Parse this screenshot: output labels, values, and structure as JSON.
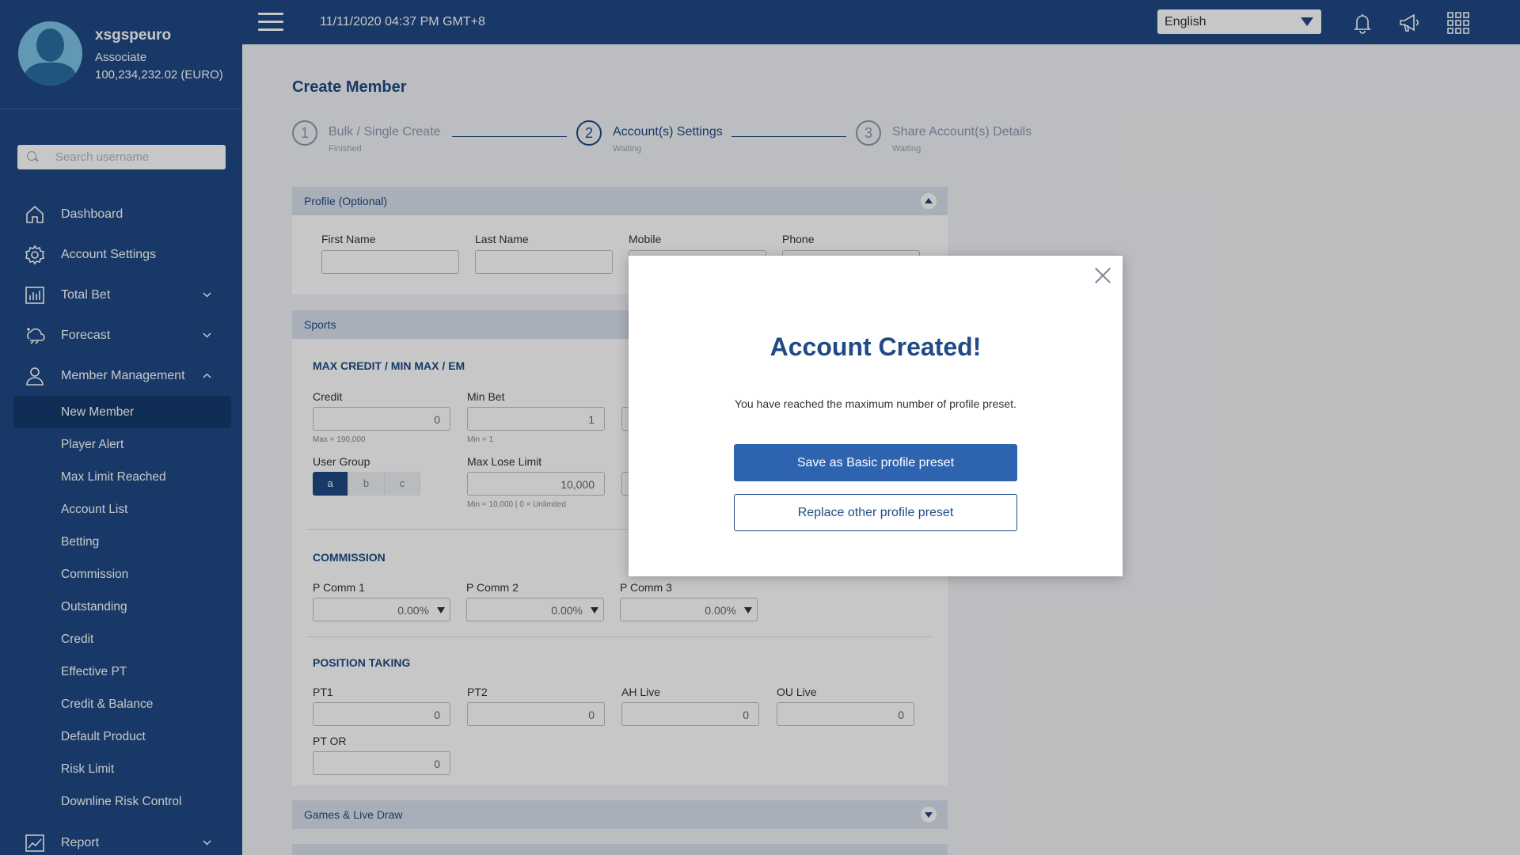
{
  "user": {
    "name": "xsgspeuro",
    "role": "Associate",
    "balance": "100,234,232.02 (EURO)"
  },
  "search": {
    "placeholder": "Search username"
  },
  "nav": {
    "dashboard": "Dashboard",
    "account_settings": "Account Settings",
    "total_bet": "Total Bet",
    "forecast": "Forecast",
    "member_management": "Member Management",
    "report": "Report",
    "member_sub": [
      "New Member",
      "Player Alert",
      "Max Limit Reached",
      "Account List",
      "Betting",
      "Commission",
      "Outstanding",
      "Credit",
      "Effective PT",
      "Credit & Balance",
      "Default Product",
      "Risk Limit",
      "Downline Risk Control"
    ]
  },
  "topbar": {
    "datetime": "11/11/2020 04:37 PM GMT+8",
    "language": "English"
  },
  "page": {
    "title": "Create Member",
    "steps": [
      {
        "num": "1",
        "title": "Bulk / Single Create",
        "status": "Finished"
      },
      {
        "num": "2",
        "title": "Account(s) Settings",
        "status": "Waiting"
      },
      {
        "num": "3",
        "title": "Share Account(s) Details",
        "status": "Waiting"
      }
    ]
  },
  "profile": {
    "header": "Profile (Optional)",
    "first_name": "First Name",
    "last_name": "Last Name",
    "mobile": "Mobile",
    "phone": "Phone"
  },
  "sports": {
    "header": "Sports",
    "max_credit_title": "MAX CREDIT / MIN MAX / EM",
    "credit_label": "Credit",
    "credit_value": "0",
    "credit_hint": "Max = 190,000",
    "min_bet_label": "Min Bet",
    "min_bet_value": "1",
    "min_bet_hint": "Min = 1",
    "user_group_label": "User Group",
    "user_groups": [
      "a",
      "b",
      "c"
    ],
    "max_lose_label": "Max Lose Limit",
    "max_lose_value": "10,000",
    "max_lose_hint": "Min = 10,000 | 0 = Unlimited",
    "commission_title": "COMMISSION",
    "pcomm1_label": "P Comm 1",
    "pcomm1_value": "0.00%",
    "pcomm2_label": "P Comm 2",
    "pcomm2_value": "0.00%",
    "pcomm3_label": "P Comm 3",
    "pcomm3_value": "0.00%",
    "position_title": "POSITION TAKING",
    "pt1_label": "PT1",
    "pt1_value": "0",
    "pt2_label": "PT2",
    "pt2_value": "0",
    "ahlive_label": "AH Live",
    "ahlive_value": "0",
    "oulive_label": "OU Live",
    "oulive_value": "0",
    "ptor_label": "PT OR",
    "ptor_value": "0"
  },
  "games": {
    "header": "Games & Live Draw"
  },
  "modal": {
    "title": "Account Created!",
    "message": "You have reached the maximum number of profile preset.",
    "primary_button": "Save as Basic profile preset",
    "secondary_button": "Replace other profile preset"
  },
  "colors": {
    "sidebar": "#1f4a86",
    "accent": "#2e63b0",
    "panel_header": "#d9e1ec"
  }
}
